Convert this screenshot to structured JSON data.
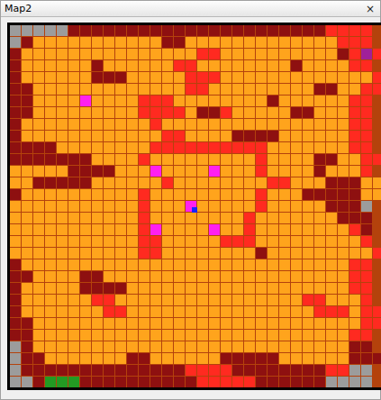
{
  "window": {
    "title": "Map2",
    "close": "×"
  },
  "legend": {
    "g": "#9c9c9c",
    "d": "#8e1010",
    "o": "#ffa41c",
    "r": "#ff2a20",
    "p": "#a0209a",
    "G": "#239a23"
  },
  "map": {
    "rows": [
      "gggggddddddddddddddddddddddrrrr",
      "gdoooooooooooddooooooooooooorrr",
      "dooooooooooooooorroooooooooodrpr",
      "doooooodoooooorroooooooodoooorr",
      "doooooodddooooorrrooooooooooooorr",
      "ddooooooooooooorroooooooooddoorr",
      "ddooooooooorrroooooooodoooooorr",
      "ddooooooooorrrroddroooooddooorr",
      "doooooooooooroooooooooooooooorr",
      "doooooooooooorrooooddddoooooorr",
      "ddddoooooooorrrrrrrrrrooooooorr",
      "dddddddoooorooooooooorooooddoorr",
      "oooooddddooorooooooooroooodooor",
      "oodddddooooooroooooooorrooodddoo",
      "doooooooooorooooooooorooodddddoo",
      "ooooooooooorooooooooorooooodddg",
      "ooooooooooorooooooooroooooooddd",
      "ooooooooooorroooooooroooooooord",
      "ooooooooooorrooooorrrooooooooor",
      "ooooooooooorroooooooodooooooooor",
      "doooooooooooooooooooooooooooorr",
      "ddooooddooooooooooooooooooooorr",
      "doooooddddooooooooooooooooooorr",
      "doooooorroooooooooooooooorrooor",
      "dooooooorroooooooooooooooorrrorr",
      "ddoooooooooooooooooooooooooooorr",
      "ddooooooooooooooooooooooooooorr",
      "gdooooooooooooooooooooooooooodd",
      "gddoooooooddoooooodddddoooooodddg",
      "gddddddddddddddrrrrddddddddrrgg",
      "ggdGGGddddddddddrrrrrddddddgggg"
    ]
  },
  "markers": [
    {
      "col": 6,
      "row": 6,
      "color": "#ff20f0"
    },
    {
      "col": 12,
      "row": 12,
      "color": "#ff20f0"
    },
    {
      "col": 17,
      "row": 12,
      "color": "#ff20f0"
    },
    {
      "col": 15,
      "row": 15,
      "color": "#ff20f0"
    },
    {
      "col": 12,
      "row": 17,
      "color": "#ff20f0"
    },
    {
      "col": 17,
      "row": 17,
      "color": "#ff20f0"
    }
  ],
  "player": {
    "col": 15,
    "row": 15,
    "color": "#1a24ff"
  }
}
